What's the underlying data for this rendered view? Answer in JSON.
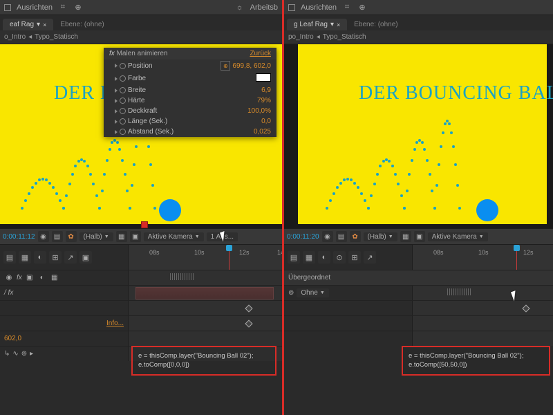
{
  "top": {
    "ausrichten": "Ausrichten",
    "arbeitsb": "Arbeitsb"
  },
  "tabs": {
    "left_name": "eaf Rag",
    "right_name": "g Leaf Rag",
    "meta": "Ebene: (ohne)"
  },
  "crumbs": {
    "a": "o_Intro",
    "b": "Typo_Statisch",
    "a2": "po_Intro"
  },
  "canvas": {
    "title_left": "DER B",
    "title_right": "DER BOUNCING BALL"
  },
  "effects": {
    "header": "Malen animieren",
    "reset": "Zurück",
    "rows": [
      {
        "name": "Position",
        "value": "699,8, 602,0",
        "pos": true
      },
      {
        "name": "Farbe",
        "value": "",
        "swatch": true
      },
      {
        "name": "Breite",
        "value": "6,9"
      },
      {
        "name": "Härte",
        "value": "79%"
      },
      {
        "name": "Deckkraft",
        "value": "100,0%"
      },
      {
        "name": "Länge (Sek.)",
        "value": "0,0"
      },
      {
        "name": "Abstand (Sek.)",
        "value": "0,025"
      }
    ]
  },
  "ctrl": {
    "tc_left": "0:00:11:12",
    "tc_right": "0:00:11:20",
    "halb": "(Halb)",
    "kamera": "Aktive Kamera",
    "ans": "1 Ans..."
  },
  "ruler": {
    "t1": "08s",
    "t2": "10s",
    "t3": "12s",
    "t4": "14"
  },
  "tl": {
    "uebergeordnet": "Übergeordnet",
    "ohne": "Ohne",
    "info": "Info...",
    "val": "602,0"
  },
  "expr": {
    "left_l1": "e = thisComp.layer(\"Bouncing Ball 02\");",
    "left_l2": "e.toComp([0,0,0])",
    "right_l1": "e = thisComp.layer(\"Bouncing Ball 02\");",
    "right_l2": "e.toComp([50,50,0])"
  }
}
